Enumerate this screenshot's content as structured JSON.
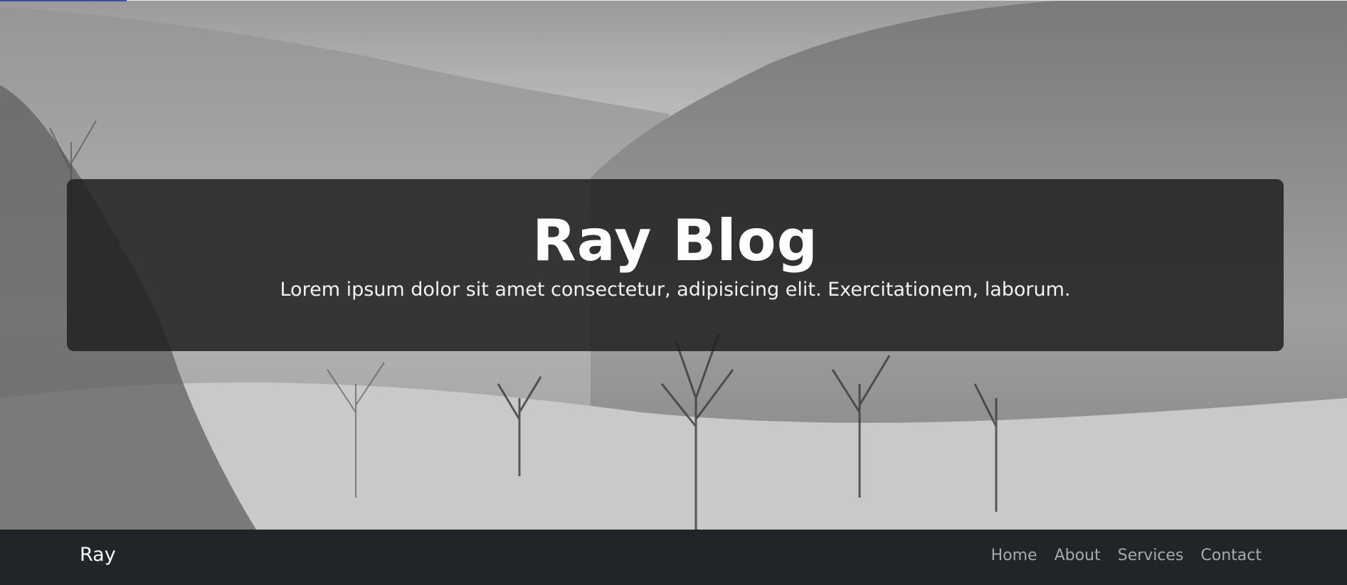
{
  "hero": {
    "title": "Ray Blog",
    "subtitle": "Lorem ipsum dolor sit amet consectetur, adipisicing elit. Exercitationem, laborum.",
    "overlay_color": "#212121",
    "image_description_icon": "misty-forest-background"
  },
  "navbar": {
    "brand": "Ray",
    "links": [
      {
        "label": "Home"
      },
      {
        "label": "About"
      },
      {
        "label": "Services"
      },
      {
        "label": "Contact"
      }
    ],
    "background_color": "#212529",
    "link_color": "#a6a9ad"
  }
}
